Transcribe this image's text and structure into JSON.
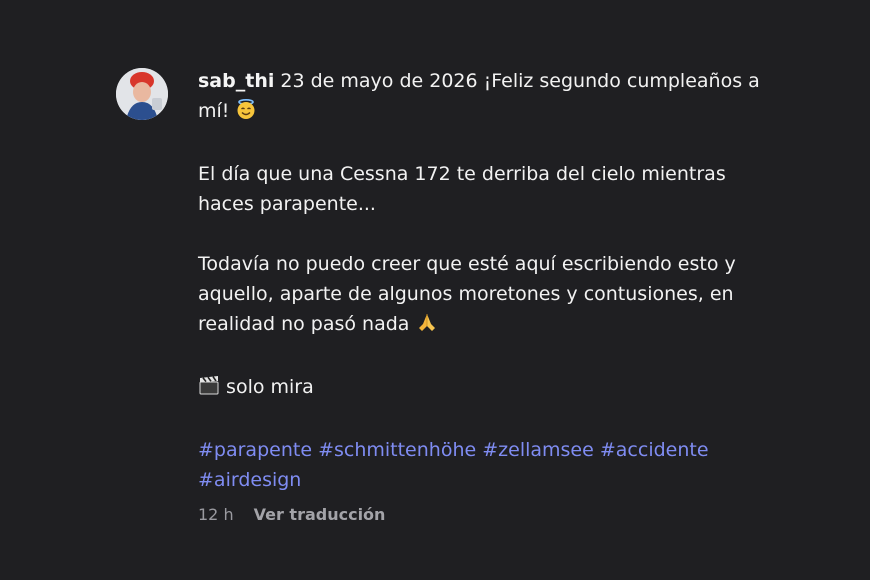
{
  "post": {
    "username": "sab_thi",
    "text_line1": " 23 de mayo de 2026 ¡Feliz segundo cumpleaños a mí! ",
    "para2": "El día que una Cessna 172 te derriba del cielo mientras haces parapente...",
    "para3": "Todavía no puedo creer que esté aquí escribiendo esto y aquello, aparte de algunos moretones y contusiones, en realidad no pasó nada ",
    "para4": " solo mira",
    "hashtags": [
      "#parapente",
      "#schmittenhöhe",
      "#zellamsee",
      "#accidente",
      "#airdesign"
    ],
    "time": "12 h",
    "translate_label": "Ver traducción"
  },
  "icons": {
    "emoji1": "smiling-face-with-halo-icon",
    "emoji2": "folded-hands-icon",
    "emoji3": "clapper-board-icon"
  },
  "colors": {
    "background": "#1f1f22",
    "text": "#f2f2f2",
    "hashtag": "#7f8cf2",
    "meta": "#9a9aa0"
  }
}
